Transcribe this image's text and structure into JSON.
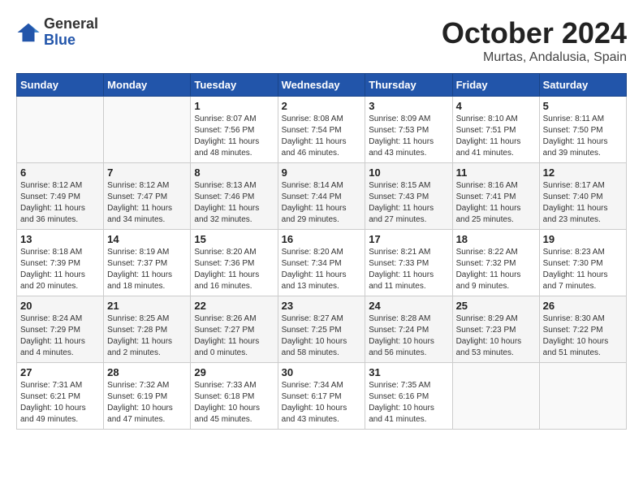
{
  "logo": {
    "general": "General",
    "blue": "Blue"
  },
  "title": "October 2024",
  "location": "Murtas, Andalusia, Spain",
  "days_of_week": [
    "Sunday",
    "Monday",
    "Tuesday",
    "Wednesday",
    "Thursday",
    "Friday",
    "Saturday"
  ],
  "weeks": [
    [
      {
        "day": "",
        "info": ""
      },
      {
        "day": "",
        "info": ""
      },
      {
        "day": "1",
        "info": "Sunrise: 8:07 AM\nSunset: 7:56 PM\nDaylight: 11 hours and 48 minutes."
      },
      {
        "day": "2",
        "info": "Sunrise: 8:08 AM\nSunset: 7:54 PM\nDaylight: 11 hours and 46 minutes."
      },
      {
        "day": "3",
        "info": "Sunrise: 8:09 AM\nSunset: 7:53 PM\nDaylight: 11 hours and 43 minutes."
      },
      {
        "day": "4",
        "info": "Sunrise: 8:10 AM\nSunset: 7:51 PM\nDaylight: 11 hours and 41 minutes."
      },
      {
        "day": "5",
        "info": "Sunrise: 8:11 AM\nSunset: 7:50 PM\nDaylight: 11 hours and 39 minutes."
      }
    ],
    [
      {
        "day": "6",
        "info": "Sunrise: 8:12 AM\nSunset: 7:49 PM\nDaylight: 11 hours and 36 minutes."
      },
      {
        "day": "7",
        "info": "Sunrise: 8:12 AM\nSunset: 7:47 PM\nDaylight: 11 hours and 34 minutes."
      },
      {
        "day": "8",
        "info": "Sunrise: 8:13 AM\nSunset: 7:46 PM\nDaylight: 11 hours and 32 minutes."
      },
      {
        "day": "9",
        "info": "Sunrise: 8:14 AM\nSunset: 7:44 PM\nDaylight: 11 hours and 29 minutes."
      },
      {
        "day": "10",
        "info": "Sunrise: 8:15 AM\nSunset: 7:43 PM\nDaylight: 11 hours and 27 minutes."
      },
      {
        "day": "11",
        "info": "Sunrise: 8:16 AM\nSunset: 7:41 PM\nDaylight: 11 hours and 25 minutes."
      },
      {
        "day": "12",
        "info": "Sunrise: 8:17 AM\nSunset: 7:40 PM\nDaylight: 11 hours and 23 minutes."
      }
    ],
    [
      {
        "day": "13",
        "info": "Sunrise: 8:18 AM\nSunset: 7:39 PM\nDaylight: 11 hours and 20 minutes."
      },
      {
        "day": "14",
        "info": "Sunrise: 8:19 AM\nSunset: 7:37 PM\nDaylight: 11 hours and 18 minutes."
      },
      {
        "day": "15",
        "info": "Sunrise: 8:20 AM\nSunset: 7:36 PM\nDaylight: 11 hours and 16 minutes."
      },
      {
        "day": "16",
        "info": "Sunrise: 8:20 AM\nSunset: 7:34 PM\nDaylight: 11 hours and 13 minutes."
      },
      {
        "day": "17",
        "info": "Sunrise: 8:21 AM\nSunset: 7:33 PM\nDaylight: 11 hours and 11 minutes."
      },
      {
        "day": "18",
        "info": "Sunrise: 8:22 AM\nSunset: 7:32 PM\nDaylight: 11 hours and 9 minutes."
      },
      {
        "day": "19",
        "info": "Sunrise: 8:23 AM\nSunset: 7:30 PM\nDaylight: 11 hours and 7 minutes."
      }
    ],
    [
      {
        "day": "20",
        "info": "Sunrise: 8:24 AM\nSunset: 7:29 PM\nDaylight: 11 hours and 4 minutes."
      },
      {
        "day": "21",
        "info": "Sunrise: 8:25 AM\nSunset: 7:28 PM\nDaylight: 11 hours and 2 minutes."
      },
      {
        "day": "22",
        "info": "Sunrise: 8:26 AM\nSunset: 7:27 PM\nDaylight: 11 hours and 0 minutes."
      },
      {
        "day": "23",
        "info": "Sunrise: 8:27 AM\nSunset: 7:25 PM\nDaylight: 10 hours and 58 minutes."
      },
      {
        "day": "24",
        "info": "Sunrise: 8:28 AM\nSunset: 7:24 PM\nDaylight: 10 hours and 56 minutes."
      },
      {
        "day": "25",
        "info": "Sunrise: 8:29 AM\nSunset: 7:23 PM\nDaylight: 10 hours and 53 minutes."
      },
      {
        "day": "26",
        "info": "Sunrise: 8:30 AM\nSunset: 7:22 PM\nDaylight: 10 hours and 51 minutes."
      }
    ],
    [
      {
        "day": "27",
        "info": "Sunrise: 7:31 AM\nSunset: 6:21 PM\nDaylight: 10 hours and 49 minutes."
      },
      {
        "day": "28",
        "info": "Sunrise: 7:32 AM\nSunset: 6:19 PM\nDaylight: 10 hours and 47 minutes."
      },
      {
        "day": "29",
        "info": "Sunrise: 7:33 AM\nSunset: 6:18 PM\nDaylight: 10 hours and 45 minutes."
      },
      {
        "day": "30",
        "info": "Sunrise: 7:34 AM\nSunset: 6:17 PM\nDaylight: 10 hours and 43 minutes."
      },
      {
        "day": "31",
        "info": "Sunrise: 7:35 AM\nSunset: 6:16 PM\nDaylight: 10 hours and 41 minutes."
      },
      {
        "day": "",
        "info": ""
      },
      {
        "day": "",
        "info": ""
      }
    ]
  ]
}
